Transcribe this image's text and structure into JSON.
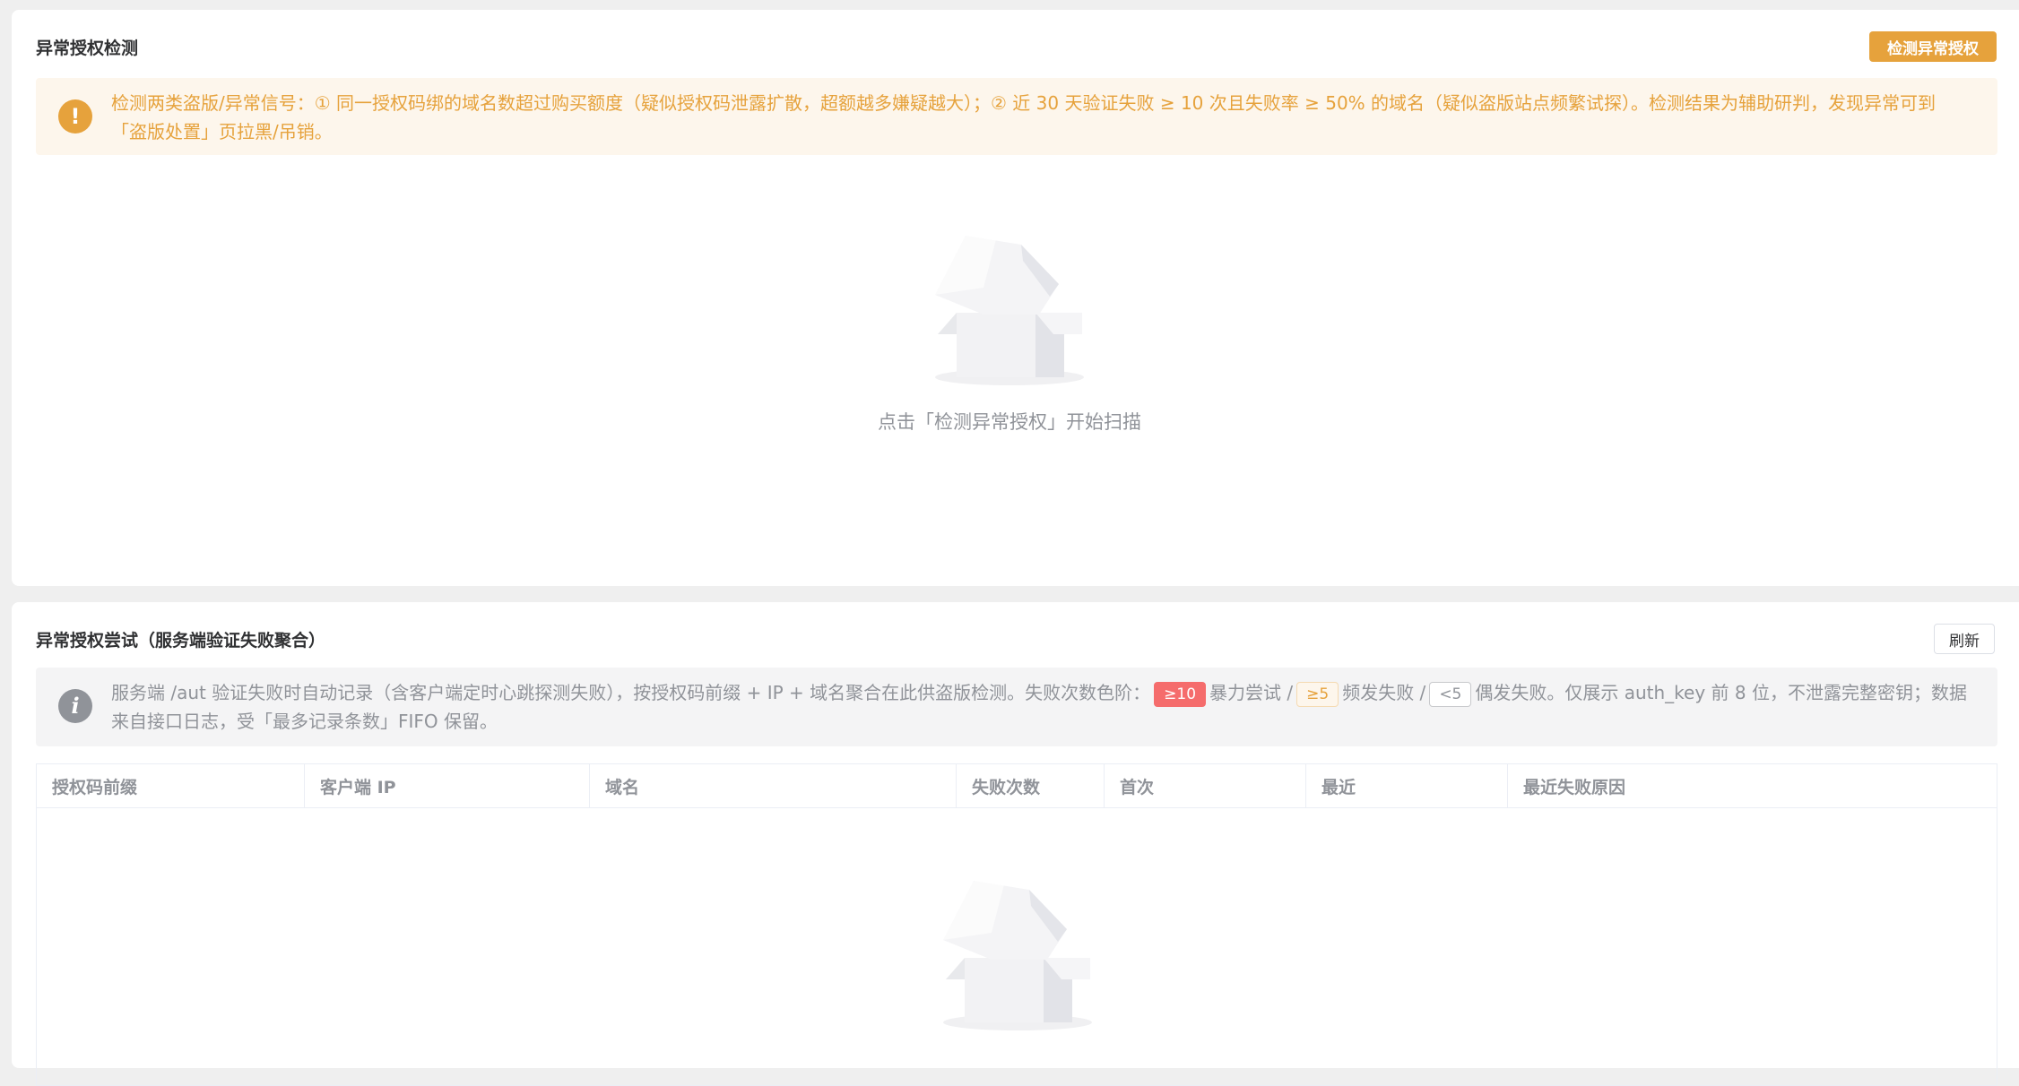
{
  "detect": {
    "title": "异常授权检测",
    "button": "检测异常授权",
    "alert_icon": "!",
    "alert_text": "检测两类盗版/异常信号：① 同一授权码绑的域名数超过购买额度（疑似授权码泄露扩散，超额越多嫌疑越大）；② 近 30 天验证失败 ≥ 10 次且失败率 ≥ 50% 的域名（疑似盗版站点频繁试探）。检测结果为辅助研判，发现异常可到「盗版处置」页拉黑/吊销。",
    "empty_text": "点击「检测异常授权」开始扫描"
  },
  "attempts": {
    "title": "异常授权尝试（服务端验证失败聚合）",
    "refresh_button": "刷新",
    "alert_icon": "i",
    "alert_text_1": "服务端 /aut 验证失败时自动记录（含客户端定时心跳探测失败），按授权码前缀 + IP + 域名聚合在此供盗版检测。失败次数色阶：",
    "tag_danger": "≥10",
    "label_danger": "暴力尝试 /",
    "tag_warning": "≥5",
    "label_warning": "频发失败 /",
    "tag_info": "<5",
    "alert_text_2": "偶发失败。仅展示 auth_key 前 8 位，不泄露完整密钥；数据来自接口日志，受「最多记录条数」FIFO 保留。",
    "columns": [
      "授权码前缀",
      "客户端 IP",
      "域名",
      "失败次数",
      "首次",
      "最近",
      "最近失败原因"
    ]
  },
  "colors": {
    "warning": "#e6a23c",
    "danger": "#f56c6c",
    "info": "#909399"
  }
}
